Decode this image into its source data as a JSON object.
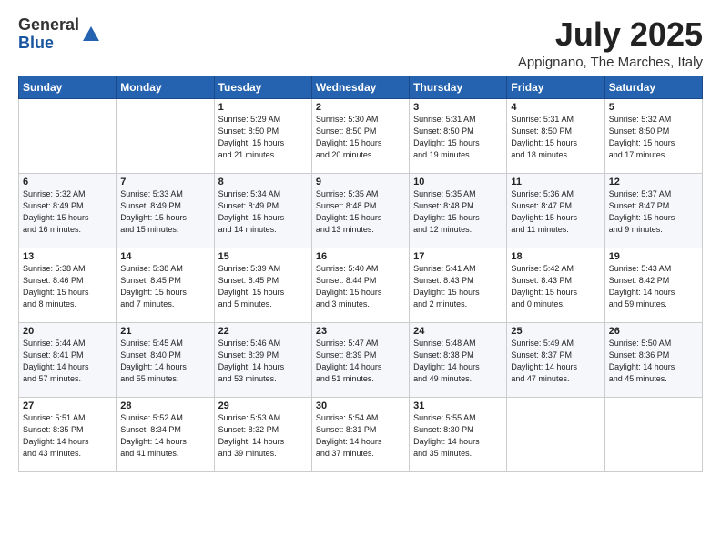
{
  "logo": {
    "general": "General",
    "blue": "Blue"
  },
  "title": "July 2025",
  "subtitle": "Appignano, The Marches, Italy",
  "header": {
    "days": [
      "Sunday",
      "Monday",
      "Tuesday",
      "Wednesday",
      "Thursday",
      "Friday",
      "Saturday"
    ]
  },
  "weeks": [
    [
      {
        "day": "",
        "info": ""
      },
      {
        "day": "",
        "info": ""
      },
      {
        "day": "1",
        "info": "Sunrise: 5:29 AM\nSunset: 8:50 PM\nDaylight: 15 hours\nand 21 minutes."
      },
      {
        "day": "2",
        "info": "Sunrise: 5:30 AM\nSunset: 8:50 PM\nDaylight: 15 hours\nand 20 minutes."
      },
      {
        "day": "3",
        "info": "Sunrise: 5:31 AM\nSunset: 8:50 PM\nDaylight: 15 hours\nand 19 minutes."
      },
      {
        "day": "4",
        "info": "Sunrise: 5:31 AM\nSunset: 8:50 PM\nDaylight: 15 hours\nand 18 minutes."
      },
      {
        "day": "5",
        "info": "Sunrise: 5:32 AM\nSunset: 8:50 PM\nDaylight: 15 hours\nand 17 minutes."
      }
    ],
    [
      {
        "day": "6",
        "info": "Sunrise: 5:32 AM\nSunset: 8:49 PM\nDaylight: 15 hours\nand 16 minutes."
      },
      {
        "day": "7",
        "info": "Sunrise: 5:33 AM\nSunset: 8:49 PM\nDaylight: 15 hours\nand 15 minutes."
      },
      {
        "day": "8",
        "info": "Sunrise: 5:34 AM\nSunset: 8:49 PM\nDaylight: 15 hours\nand 14 minutes."
      },
      {
        "day": "9",
        "info": "Sunrise: 5:35 AM\nSunset: 8:48 PM\nDaylight: 15 hours\nand 13 minutes."
      },
      {
        "day": "10",
        "info": "Sunrise: 5:35 AM\nSunset: 8:48 PM\nDaylight: 15 hours\nand 12 minutes."
      },
      {
        "day": "11",
        "info": "Sunrise: 5:36 AM\nSunset: 8:47 PM\nDaylight: 15 hours\nand 11 minutes."
      },
      {
        "day": "12",
        "info": "Sunrise: 5:37 AM\nSunset: 8:47 PM\nDaylight: 15 hours\nand 9 minutes."
      }
    ],
    [
      {
        "day": "13",
        "info": "Sunrise: 5:38 AM\nSunset: 8:46 PM\nDaylight: 15 hours\nand 8 minutes."
      },
      {
        "day": "14",
        "info": "Sunrise: 5:38 AM\nSunset: 8:45 PM\nDaylight: 15 hours\nand 7 minutes."
      },
      {
        "day": "15",
        "info": "Sunrise: 5:39 AM\nSunset: 8:45 PM\nDaylight: 15 hours\nand 5 minutes."
      },
      {
        "day": "16",
        "info": "Sunrise: 5:40 AM\nSunset: 8:44 PM\nDaylight: 15 hours\nand 3 minutes."
      },
      {
        "day": "17",
        "info": "Sunrise: 5:41 AM\nSunset: 8:43 PM\nDaylight: 15 hours\nand 2 minutes."
      },
      {
        "day": "18",
        "info": "Sunrise: 5:42 AM\nSunset: 8:43 PM\nDaylight: 15 hours\nand 0 minutes."
      },
      {
        "day": "19",
        "info": "Sunrise: 5:43 AM\nSunset: 8:42 PM\nDaylight: 14 hours\nand 59 minutes."
      }
    ],
    [
      {
        "day": "20",
        "info": "Sunrise: 5:44 AM\nSunset: 8:41 PM\nDaylight: 14 hours\nand 57 minutes."
      },
      {
        "day": "21",
        "info": "Sunrise: 5:45 AM\nSunset: 8:40 PM\nDaylight: 14 hours\nand 55 minutes."
      },
      {
        "day": "22",
        "info": "Sunrise: 5:46 AM\nSunset: 8:39 PM\nDaylight: 14 hours\nand 53 minutes."
      },
      {
        "day": "23",
        "info": "Sunrise: 5:47 AM\nSunset: 8:39 PM\nDaylight: 14 hours\nand 51 minutes."
      },
      {
        "day": "24",
        "info": "Sunrise: 5:48 AM\nSunset: 8:38 PM\nDaylight: 14 hours\nand 49 minutes."
      },
      {
        "day": "25",
        "info": "Sunrise: 5:49 AM\nSunset: 8:37 PM\nDaylight: 14 hours\nand 47 minutes."
      },
      {
        "day": "26",
        "info": "Sunrise: 5:50 AM\nSunset: 8:36 PM\nDaylight: 14 hours\nand 45 minutes."
      }
    ],
    [
      {
        "day": "27",
        "info": "Sunrise: 5:51 AM\nSunset: 8:35 PM\nDaylight: 14 hours\nand 43 minutes."
      },
      {
        "day": "28",
        "info": "Sunrise: 5:52 AM\nSunset: 8:34 PM\nDaylight: 14 hours\nand 41 minutes."
      },
      {
        "day": "29",
        "info": "Sunrise: 5:53 AM\nSunset: 8:32 PM\nDaylight: 14 hours\nand 39 minutes."
      },
      {
        "day": "30",
        "info": "Sunrise: 5:54 AM\nSunset: 8:31 PM\nDaylight: 14 hours\nand 37 minutes."
      },
      {
        "day": "31",
        "info": "Sunrise: 5:55 AM\nSunset: 8:30 PM\nDaylight: 14 hours\nand 35 minutes."
      },
      {
        "day": "",
        "info": ""
      },
      {
        "day": "",
        "info": ""
      }
    ]
  ]
}
